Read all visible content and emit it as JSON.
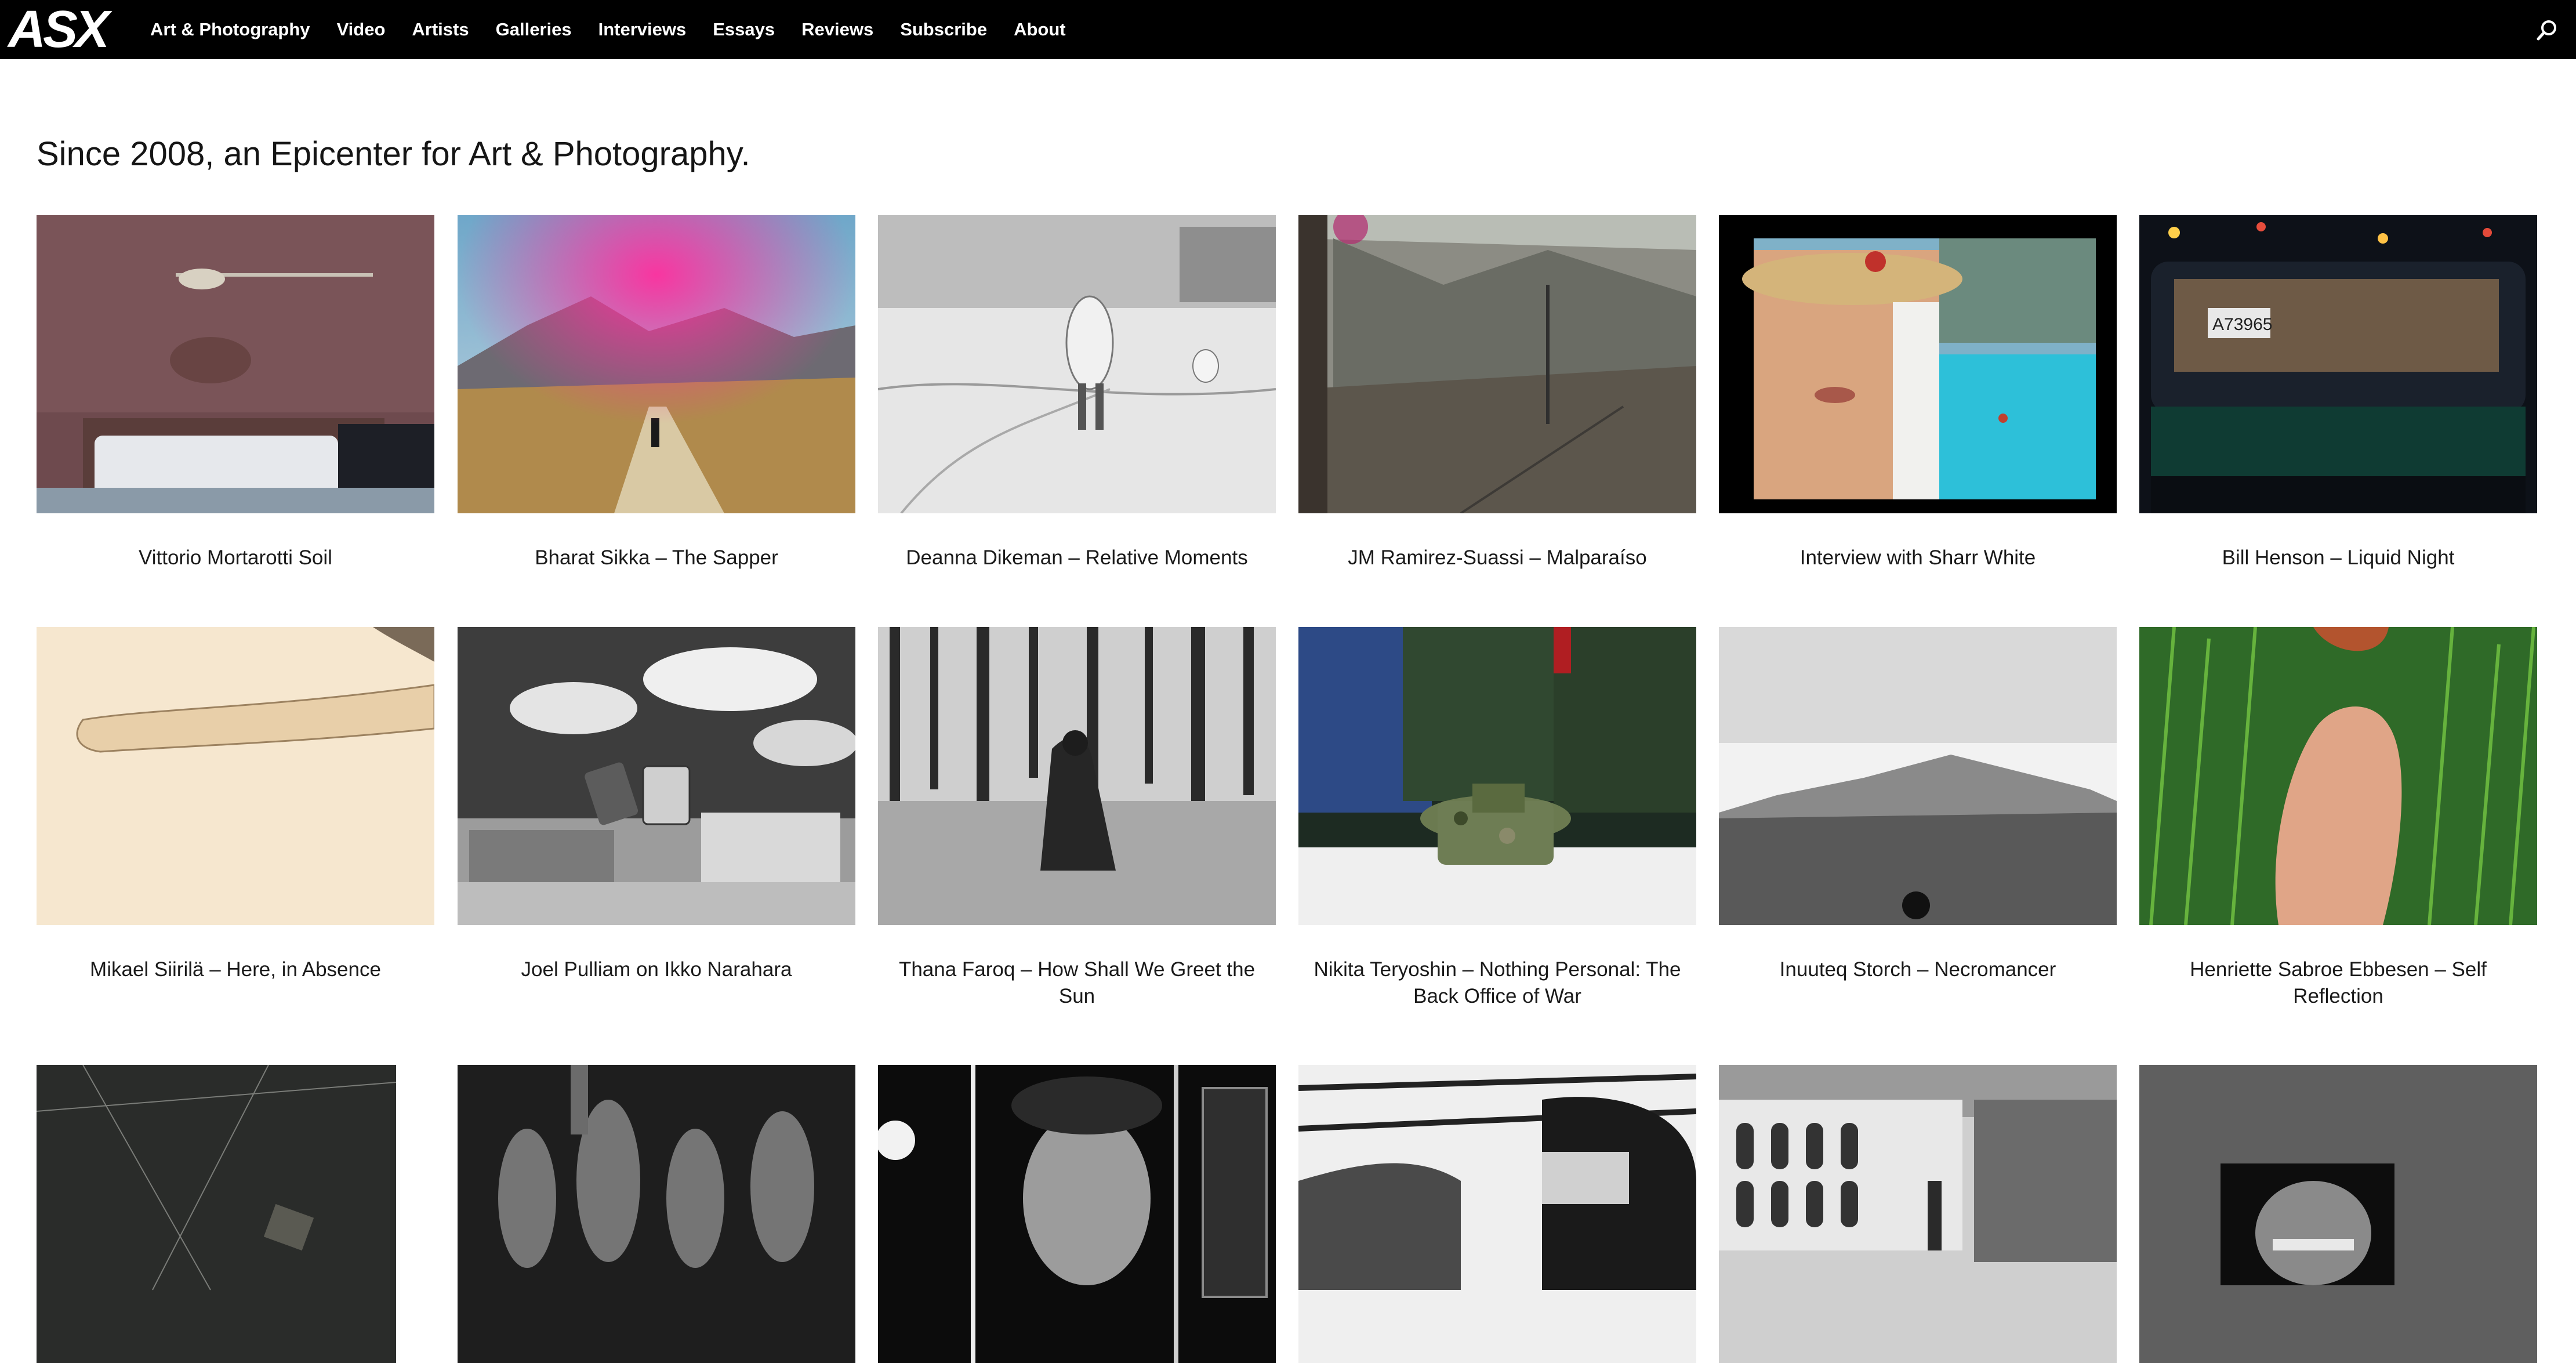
{
  "site": {
    "logo": "ASX"
  },
  "nav": {
    "items": [
      {
        "label": "Art & Photography"
      },
      {
        "label": "Video"
      },
      {
        "label": "Artists"
      },
      {
        "label": "Galleries"
      },
      {
        "label": "Interviews"
      },
      {
        "label": "Essays"
      },
      {
        "label": "Reviews"
      },
      {
        "label": "Subscribe"
      },
      {
        "label": "About"
      }
    ]
  },
  "main": {
    "heading": "Since 2008, an Epicenter for Art & Photography.",
    "posts": [
      {
        "title": "Vittorio Mortarotti Soil"
      },
      {
        "title": "Bharat Sikka – The Sapper"
      },
      {
        "title": "Deanna Dikeman – Relative Moments"
      },
      {
        "title": "JM Ramirez-Suassi – Malparaíso"
      },
      {
        "title": "Interview with Sharr White"
      },
      {
        "title": "Bill Henson – Liquid Night"
      },
      {
        "title": "Mikael Siirilä – Here, in Absence"
      },
      {
        "title": "Joel Pulliam on Ikko Narahara"
      },
      {
        "title": "Thana Faroq – How Shall We Greet the Sun"
      },
      {
        "title": "Nikita Teryoshin – Nothing Personal: The Back Office of War"
      },
      {
        "title": "Inuuteq Storch – Necromancer"
      },
      {
        "title": "Henriette Sabroe Ebbesen – Self Reflection"
      },
      {
        "title": ""
      },
      {
        "title": ""
      },
      {
        "title": ""
      },
      {
        "title": ""
      },
      {
        "title": ""
      },
      {
        "title": ""
      }
    ]
  },
  "thumb_license": {
    "car_plate": "A73965"
  }
}
